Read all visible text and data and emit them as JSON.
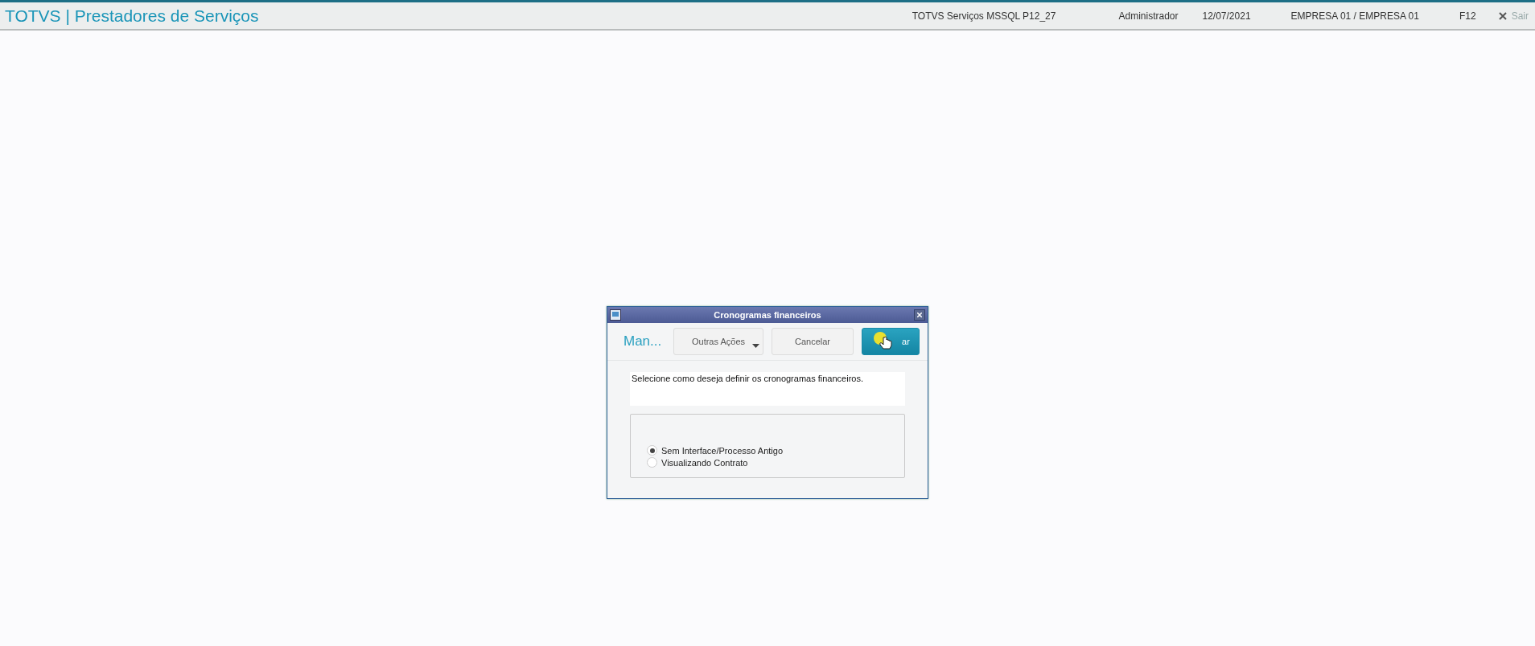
{
  "app_bar": {
    "title": "TOTVS | Prestadores de Serviços",
    "environment": "TOTVS Serviços MSSQL P12_27",
    "user": "Administrador",
    "date": "12/07/2021",
    "company": "EMPRESA 01 / EMPRESA 01",
    "help_key": "F12",
    "exit": "Sair"
  },
  "dialog": {
    "title": "Cronogramas financeiros",
    "heading": "Man...",
    "buttons": [
      {
        "label": "Outras Ações",
        "kind": "menu"
      },
      {
        "label": "Cancelar",
        "kind": "plain"
      },
      {
        "label": "ar",
        "kind": "primary"
      }
    ],
    "message": "Selecione como deseja definir os cronogramas financeiros.",
    "options": [
      {
        "label": "Sem Interface/Processo Antigo",
        "selected": true
      },
      {
        "label": "Visualizando Contrato",
        "selected": false
      }
    ]
  }
}
